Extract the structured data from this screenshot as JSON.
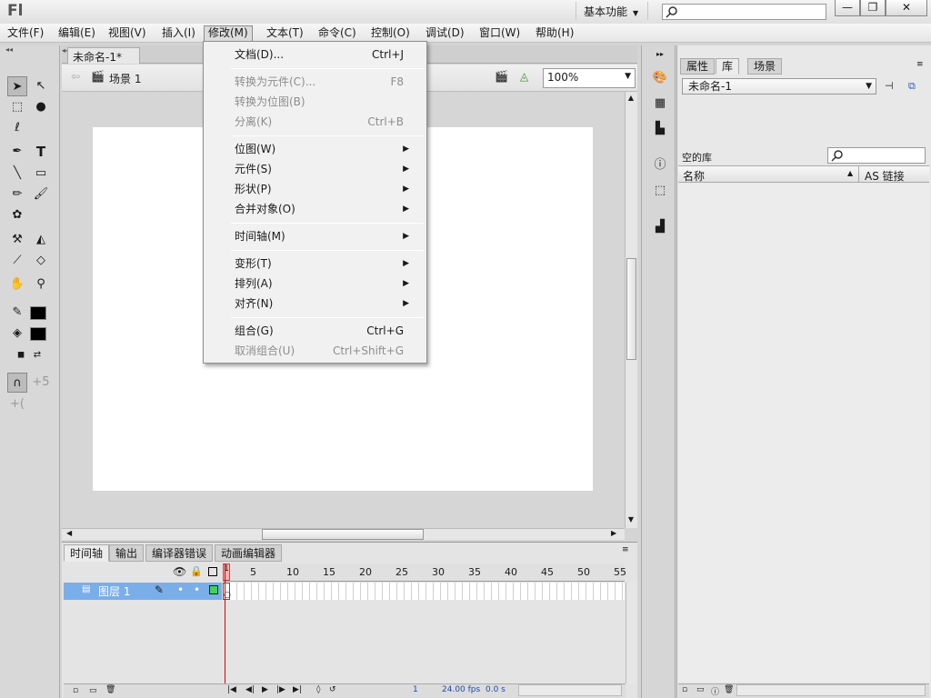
{
  "app": {
    "logo": "Fl",
    "workspace": "基本功能",
    "window_buttons": {
      "minimize": "—",
      "restore": "❐",
      "close": "✕"
    }
  },
  "menubar": [
    "文件(F)",
    "编辑(E)",
    "视图(V)",
    "插入(I)",
    "修改(M)",
    "文本(T)",
    "命令(C)",
    "控制(O)",
    "调试(D)",
    "窗口(W)",
    "帮助(H)"
  ],
  "document": {
    "tab_title": "未命名-1*",
    "tab_close": "×",
    "scene_label": "场景 1",
    "zoom": "100%"
  },
  "dropdown": {
    "items": [
      {
        "label": "文档(D)...",
        "shortcut": "Ctrl+J",
        "disabled": false,
        "submenu": false
      },
      {
        "label": "转换为元件(C)...",
        "shortcut": "F8",
        "disabled": true,
        "submenu": false
      },
      {
        "label": "转换为位图(B)",
        "shortcut": "",
        "disabled": true,
        "submenu": false
      },
      {
        "label": "分离(K)",
        "shortcut": "Ctrl+B",
        "disabled": true,
        "submenu": false
      },
      {
        "label": "位图(W)",
        "shortcut": "",
        "disabled": false,
        "submenu": true
      },
      {
        "label": "元件(S)",
        "shortcut": "",
        "disabled": false,
        "submenu": true
      },
      {
        "label": "形状(P)",
        "shortcut": "",
        "disabled": false,
        "submenu": true
      },
      {
        "label": "合并对象(O)",
        "shortcut": "",
        "disabled": false,
        "submenu": true
      },
      {
        "label": "时间轴(M)",
        "shortcut": "",
        "disabled": false,
        "submenu": true
      },
      {
        "label": "变形(T)",
        "shortcut": "",
        "disabled": false,
        "submenu": true
      },
      {
        "label": "排列(A)",
        "shortcut": "",
        "disabled": false,
        "submenu": true
      },
      {
        "label": "对齐(N)",
        "shortcut": "",
        "disabled": false,
        "submenu": true
      },
      {
        "label": "组合(G)",
        "shortcut": "Ctrl+G",
        "disabled": false,
        "submenu": false
      },
      {
        "label": "取消组合(U)",
        "shortcut": "Ctrl+Shift+G",
        "disabled": true,
        "submenu": false
      }
    ]
  },
  "timeline": {
    "tabs": [
      "时间轴",
      "输出",
      "编译器错误",
      "动画编辑器"
    ],
    "frame_numbers": [
      "1",
      "5",
      "10",
      "15",
      "20",
      "25",
      "30",
      "35",
      "40",
      "45",
      "50",
      "55"
    ],
    "layer_name": "图层 1",
    "status": {
      "current_frame": "1",
      "fps": "24.00 fps",
      "time": "0.0 s"
    }
  },
  "library": {
    "tabs": [
      "属性",
      "库",
      "场景"
    ],
    "document_select": "未命名-1",
    "empty_label": "空的库",
    "col_name": "名称",
    "col_link": "AS 链接"
  },
  "colors": {
    "stroke": "#000000",
    "fill": "#000000",
    "layer_selected": "#7aaee8",
    "playhead": "#dd0000"
  }
}
